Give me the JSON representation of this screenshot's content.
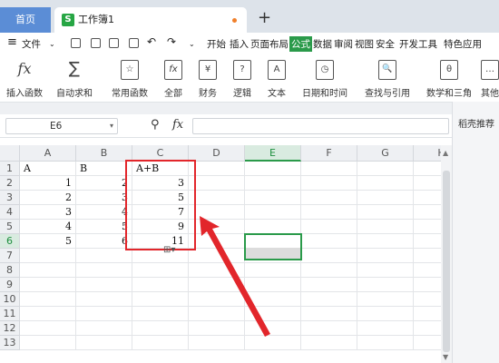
{
  "tabs": {
    "home": "首页",
    "doc": "工作簿1",
    "doc_icon": "S",
    "new_tab": "+"
  },
  "menu": {
    "file": "文件",
    "items": [
      "开始",
      "插入",
      "页面布局",
      "公式",
      "数据",
      "审阅",
      "视图",
      "安全",
      "开发工具",
      "特色应用"
    ],
    "active": "公式"
  },
  "ribbon": [
    {
      "label": "插入函数",
      "icon": "fx"
    },
    {
      "label": "自动求和",
      "icon": "∑"
    },
    {
      "label": "常用函数",
      "icon": "☆"
    },
    {
      "label": "全部",
      "icon": "fx"
    },
    {
      "label": "财务",
      "icon": "¥"
    },
    {
      "label": "逻辑",
      "icon": "?"
    },
    {
      "label": "文本",
      "icon": "A"
    },
    {
      "label": "日期和时间",
      "icon": "◷"
    },
    {
      "label": "查找与引用",
      "icon": "🔍"
    },
    {
      "label": "数学和三角",
      "icon": "θ"
    },
    {
      "label": "其他",
      "icon": "…"
    }
  ],
  "formula_bar": {
    "name_box": "E6",
    "fx_label": "fx",
    "formula": ""
  },
  "side_panel": {
    "title": "稻壳推荐"
  },
  "sheet": {
    "columns": [
      "A",
      "B",
      "C",
      "D",
      "E",
      "F",
      "G",
      "H"
    ],
    "rows": [
      "1",
      "2",
      "3",
      "4",
      "5",
      "6",
      "7",
      "8",
      "9",
      "10",
      "11",
      "12",
      "13"
    ],
    "selected_cell": "E6",
    "cells": [
      [
        "A",
        "B",
        "A+B"
      ],
      [
        "1",
        "2",
        "3"
      ],
      [
        "2",
        "3",
        "5"
      ],
      [
        "3",
        "4",
        "7"
      ],
      [
        "4",
        "5",
        "9"
      ],
      [
        "5",
        "6",
        "11"
      ]
    ]
  },
  "colors": {
    "accent_green": "#2a9a4a",
    "annotation_red": "#e2262b",
    "home_tab": "#5b8dd6"
  }
}
